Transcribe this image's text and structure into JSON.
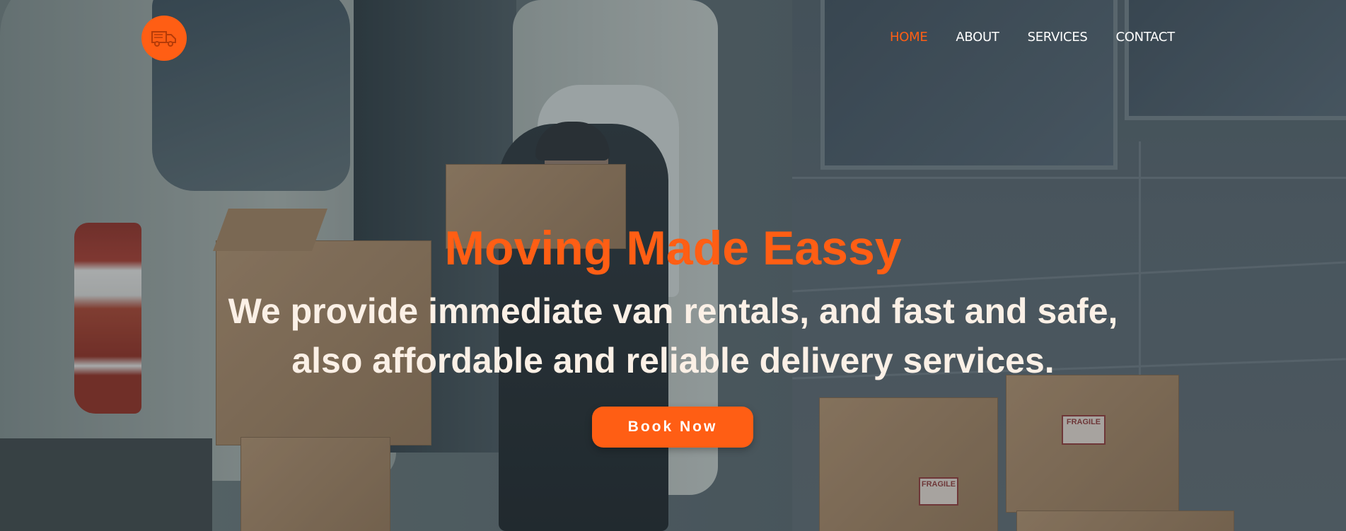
{
  "nav": {
    "logo_icon": "delivery-truck-icon",
    "items": [
      {
        "label": "HOME",
        "active": true
      },
      {
        "label": "ABOUT",
        "active": false
      },
      {
        "label": "SERVICES",
        "active": false
      },
      {
        "label": "CONTACT",
        "active": false
      }
    ]
  },
  "hero": {
    "headline": "Moving Made Eassy",
    "subline_1": "We provide immediate van rentals, and fast and safe,",
    "subline_2": "also affordable and reliable delivery services.",
    "cta_label": "Book Now"
  },
  "background": {
    "box_labels": [
      "FRAGILE",
      "FRAGILE"
    ]
  },
  "colors": {
    "accent": "#ff5e14",
    "nav_text": "#ffffff",
    "subline_text": "#fbf0e6"
  }
}
